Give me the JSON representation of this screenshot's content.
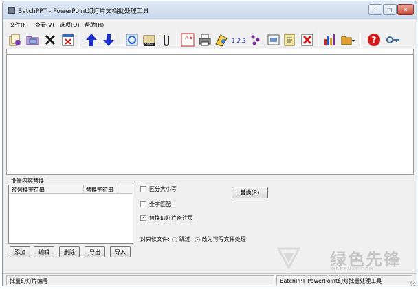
{
  "window": {
    "title": "BatchPPT - PowerPoint幻灯片文档批处理工具"
  },
  "window_controls": {
    "minimize": "─",
    "maximize": "□",
    "close": "✕"
  },
  "menu": [
    {
      "label": "文件(F)"
    },
    {
      "label": "查看(V)"
    },
    {
      "label": "选项(O)"
    },
    {
      "label": "帮助(H)"
    }
  ],
  "toolbar": {
    "icons": [
      "open-files-icon",
      "open-folder-icon",
      "delete-icon",
      "clear-list-icon",
      "move-up-icon",
      "move-down-icon",
      "internet-explorer-icon",
      "slides-icon",
      "attachment-icon",
      "replace-text-icon",
      "printer-icon",
      "convert-icon",
      "numbering-icon",
      "properties-icon",
      "slide-window-icon",
      "document-icon",
      "remove-icon",
      "chart-icon",
      "export-dropdown-icon",
      "help-icon",
      "key-icon"
    ],
    "labels": {
      "numbering": "1 2 3",
      "slides": "Slides",
      "letters": "A B"
    },
    "colors": {
      "arrow": "#1e2fd0",
      "help": "#d21b1b",
      "delete": "#d01818"
    }
  },
  "replace_panel": {
    "title": "批量内容替换",
    "columns": [
      "被替换字符串",
      "替换字符串"
    ],
    "buttons": {
      "add": "添加",
      "edit": "编辑",
      "delete": "删除",
      "export": "导出",
      "import": "导入",
      "replace": "替换(R)"
    },
    "options": {
      "case_sensitive": {
        "label": "区分大小写",
        "checked": false,
        "mark": ""
      },
      "whole_word": {
        "label": "全字匹配",
        "checked": false,
        "mark": ""
      },
      "replace_notes": {
        "label": "替换幻灯片备注页",
        "checked": true,
        "mark": "✓"
      }
    },
    "readonly": {
      "label": "对只读文件:",
      "skip": "跳过",
      "writable": "改为可写文件处理",
      "selected": "改为可写文件处理"
    }
  },
  "statusbar": {
    "left": "批量幻灯片编号",
    "right": "BatchPPT PowerPoint幻灯批量处理工具"
  },
  "watermark": {
    "text": "绿色先锋",
    "sub": "GREENXF.COM"
  }
}
